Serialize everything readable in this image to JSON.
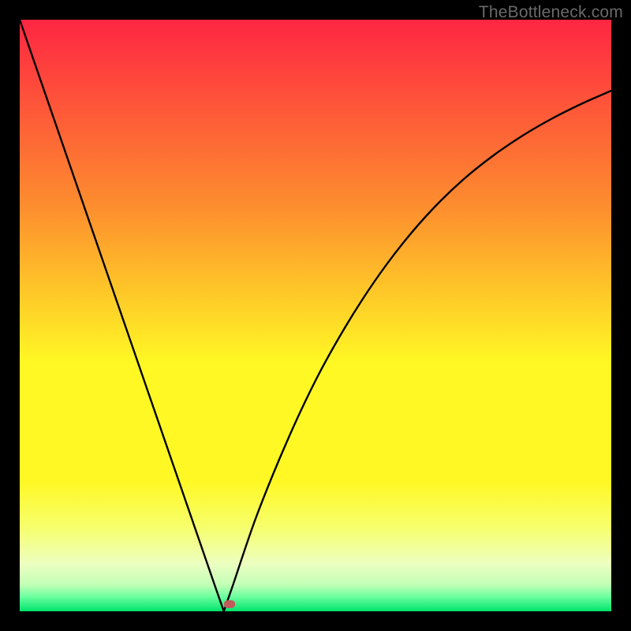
{
  "watermark": "TheBottleneck.com",
  "colors": {
    "frame": "#000000",
    "top": "#fe2642",
    "mid_upper": "#fd8f2e",
    "mid": "#fff824",
    "lower": "#f6ff6e",
    "pale": "#ecffc1",
    "mint": "#c2ffb6",
    "green": "#00e46c",
    "curve": "#000000",
    "marker": "#c15b5b"
  },
  "chart_data": {
    "type": "line",
    "title": "",
    "xlabel": "",
    "ylabel": "",
    "xlim": [
      0,
      1
    ],
    "ylim": [
      0,
      1
    ],
    "x": [
      0.0,
      0.05,
      0.1,
      0.15,
      0.2,
      0.25,
      0.3,
      0.33,
      0.345,
      0.36,
      0.4,
      0.45,
      0.5,
      0.55,
      0.6,
      0.65,
      0.7,
      0.75,
      0.8,
      0.85,
      0.9,
      0.95,
      1.0
    ],
    "values": [
      1.0,
      0.855,
      0.71,
      0.565,
      0.42,
      0.275,
      0.13,
      0.043,
      0.0,
      0.043,
      0.16,
      0.283,
      0.39,
      0.48,
      0.558,
      0.625,
      0.682,
      0.73,
      0.77,
      0.804,
      0.833,
      0.858,
      0.88
    ],
    "minimum": {
      "x": 0.345,
      "y": 0.0
    },
    "marker": {
      "x": 0.355,
      "y": 0.012
    }
  }
}
